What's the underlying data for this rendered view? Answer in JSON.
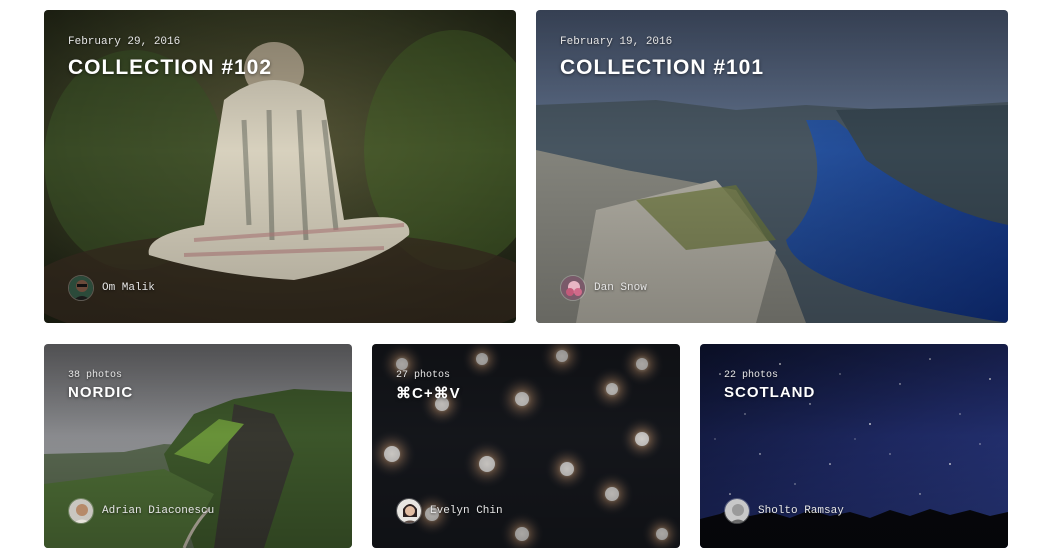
{
  "collections": [
    {
      "date": "February 29, 2016",
      "title": "COLLECTION #102",
      "author": "Om Malik"
    },
    {
      "date": "February 19, 2016",
      "title": "COLLECTION #101",
      "author": "Dan Snow"
    },
    {
      "count": "38 photos",
      "title": "NORDIC",
      "author": "Adrian Diaconescu"
    },
    {
      "count": "27 photos",
      "title": "⌘C+⌘V",
      "author": "Evelyn Chin"
    },
    {
      "count": "22 photos",
      "title": "SCOTLAND",
      "author": "Sholto Ramsay"
    }
  ]
}
